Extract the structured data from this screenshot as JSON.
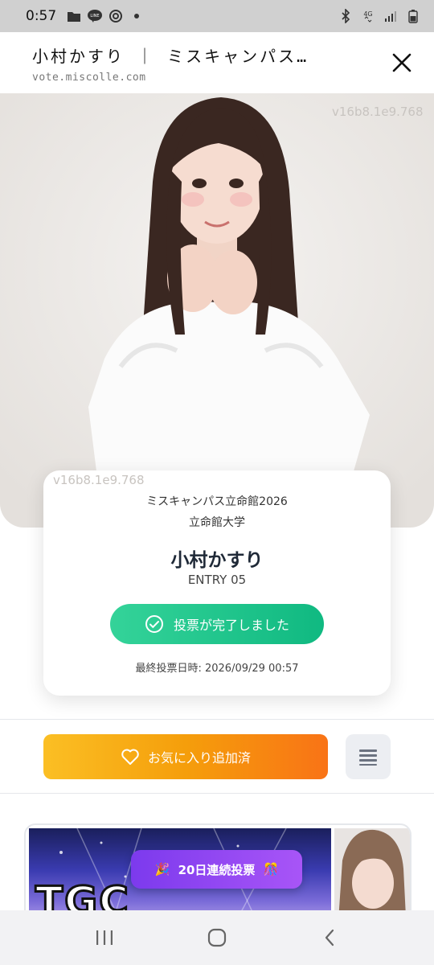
{
  "status_bar": {
    "time": "0:57",
    "left_icons": [
      "folder-icon",
      "line-icon",
      "threads-icon",
      "dot-icon"
    ],
    "right_icons": [
      "bluetooth-icon",
      "4g-icon",
      "signal-icon",
      "battery-icon"
    ],
    "network": "4G"
  },
  "header": {
    "title": "小村かすり ｜ ミスキャンパス立…",
    "subtitle": "vote.miscolle.com",
    "close_icon": "close-icon"
  },
  "photo": {
    "watermark": "v16b8.1e9.768"
  },
  "card": {
    "contest": "ミスキャンパス立命館2026",
    "university": "立命館大学",
    "name": "小村かすり",
    "entry": "ENTRY 05",
    "vote_button_label": "投票が完了しました",
    "last_vote_label": "最終投票日時: 2026/09/29 00:57",
    "watermark": "v16b8.1e9.768"
  },
  "actions": {
    "favorite_label": "お気に入り追加済",
    "menu_icon": "menu-icon"
  },
  "banner": {
    "text": "TGC CAMPUS",
    "streak_label": "20日連続投票"
  },
  "nav_bar": {
    "items": [
      "recent-apps-icon",
      "home-icon",
      "back-icon"
    ]
  },
  "colors": {
    "vote_green": "#10b981",
    "favorite_orange": "#f59e0b",
    "streak_purple": "#7c3aed"
  }
}
